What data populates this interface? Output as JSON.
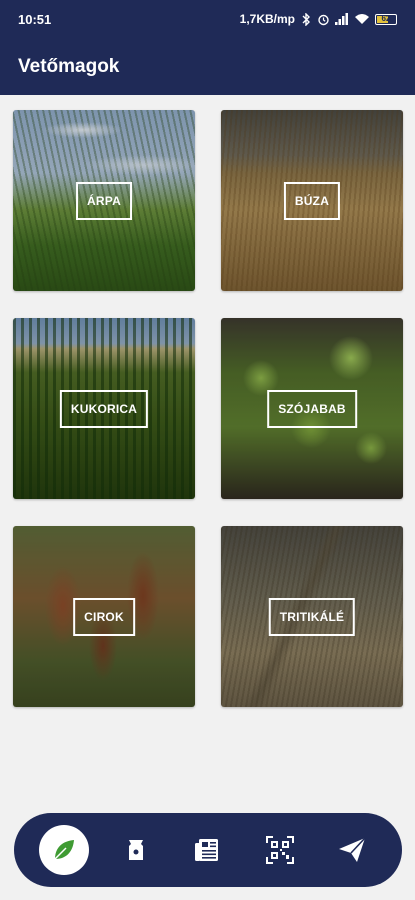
{
  "status_bar": {
    "time": "10:51",
    "network_speed": "1,7KB/mp",
    "battery_level": "62",
    "icons": [
      "bluetooth-icon",
      "alarm-icon",
      "signal-icon",
      "wifi-icon",
      "battery-icon"
    ]
  },
  "app_bar": {
    "title": "Vetőmagok"
  },
  "categories": [
    {
      "label": "ÁRPA"
    },
    {
      "label": "BÚZA"
    },
    {
      "label": "KUKORICA"
    },
    {
      "label": "SZÓJABAB"
    },
    {
      "label": "CIROK"
    },
    {
      "label": "TRITIKÁLÉ"
    }
  ],
  "bottom_nav": {
    "items": [
      {
        "icon": "leaf-icon",
        "active": true
      },
      {
        "icon": "seed-bag-icon",
        "active": false
      },
      {
        "icon": "news-icon",
        "active": false
      },
      {
        "icon": "qr-code-icon",
        "active": false
      },
      {
        "icon": "send-icon",
        "active": false
      }
    ]
  },
  "colors": {
    "primary": "#1f2a57",
    "background": "#f1f1f1",
    "accent_green": "#3f9b33"
  }
}
